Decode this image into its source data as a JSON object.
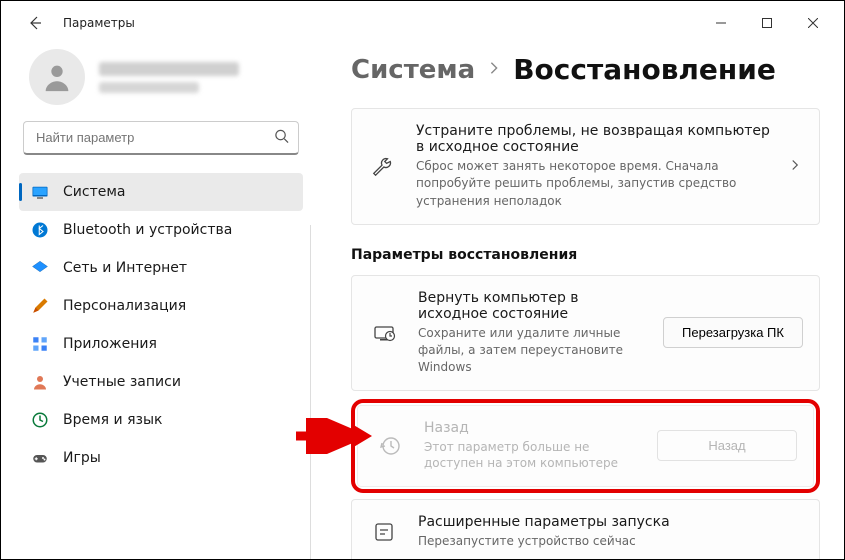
{
  "appTitle": "Параметры",
  "search": {
    "placeholder": "Найти параметр"
  },
  "nav": [
    {
      "label": "Система"
    },
    {
      "label": "Bluetooth и устройства"
    },
    {
      "label": "Сеть и Интернет"
    },
    {
      "label": "Персонализация"
    },
    {
      "label": "Приложения"
    },
    {
      "label": "Учетные записи"
    },
    {
      "label": "Время и язык"
    },
    {
      "label": "Игры"
    }
  ],
  "breadcrumb": {
    "root": "Система",
    "page": "Восстановление"
  },
  "troubleshoot": {
    "title": "Устраните проблемы, не возвращая компьютер в исходное состояние",
    "sub": "Сброс может занять некоторое время. Сначала попробуйте решить проблемы, запустив средство устранения неполадок"
  },
  "sectionTitle": "Параметры восстановления",
  "reset": {
    "title": "Вернуть компьютер в исходное состояние",
    "sub": "Сохраните или удалите личные файлы, а затем переустановите Windows",
    "button": "Перезагрузка ПК"
  },
  "goback": {
    "title": "Назад",
    "sub": "Этот параметр больше не доступен на этом компьютере",
    "button": "Назад"
  },
  "advanced": {
    "title": "Расширенные параметры запуска",
    "sub": "Перезапустите устройство сейчас"
  }
}
